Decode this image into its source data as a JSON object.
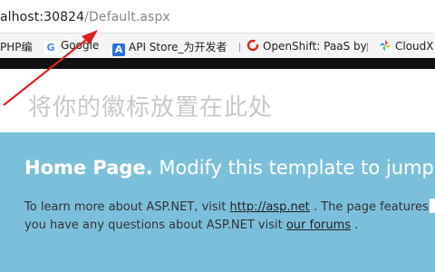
{
  "browser": {
    "address": {
      "host": "alhost:30824",
      "path": "/Default.aspx"
    },
    "bookmarks": [
      {
        "label": "PHP编",
        "icon": "doc-icon"
      },
      {
        "label": "Google",
        "icon": "google-icon",
        "icon_glyph": "G"
      },
      {
        "label": "API Store_为开发者",
        "icon": "api-store-icon",
        "icon_glyph": "A"
      },
      {
        "label": "OpenShift: PaaS by",
        "icon": "openshift-icon"
      },
      {
        "label": "CloudX",
        "icon": "cloudx-icon"
      }
    ]
  },
  "page": {
    "logo_placeholder": "将你的徽标放置在此处",
    "featured": {
      "title_bold": "Home Page.",
      "title_rest": "Modify this template to jump",
      "line1_before": "To learn more about ASP.NET, visit",
      "line1_link": "http://asp.net",
      "line1_after": ". The page features",
      "line2_before": "you have any questions about ASP.NET visit",
      "line2_link": "our forums",
      "line2_after": "."
    }
  },
  "colors": {
    "featured_bg": "#7ac0da",
    "arrow": "#e02020"
  }
}
